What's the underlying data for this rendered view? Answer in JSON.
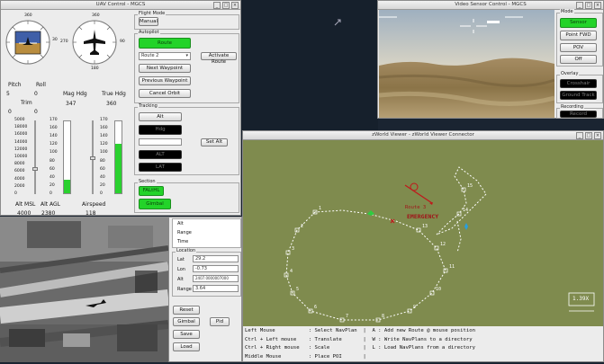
{
  "uav_window": {
    "title": "UAV Control - MGCS",
    "compass_left_labels": {
      "top": "360",
      "right": "30"
    },
    "compass_right_labels": {
      "top": "360",
      "left": "270",
      "right": "90",
      "bottom": "180"
    },
    "pitch_label": "Pitch",
    "pitch_value": "5",
    "roll_label": "Roll",
    "roll_value": "0",
    "trim_label": "Trim",
    "trim_left": "0",
    "trim_right": "0",
    "mag_hdg_label": "Mag Hdg",
    "mag_hdg_value": "347",
    "true_hdg_label": "True Hdg",
    "true_hdg_value": "360",
    "alt_msl_ticks": [
      "5000",
      "18000",
      "16000",
      "14000",
      "12000",
      "10000",
      "8000",
      "6000",
      "4000",
      "2000",
      "0"
    ],
    "alt_agl_ticks": [
      "170",
      "160",
      "140",
      "120",
      "100",
      "80",
      "60",
      "40",
      "20",
      "0"
    ],
    "airspeed_ticks": [
      "170",
      "160",
      "140",
      "120",
      "100",
      "80",
      "60",
      "40",
      "20",
      "0"
    ],
    "alt_msl_label": "Alt MSL",
    "alt_msl_value": "4000",
    "alt_agl_label": "Alt AGL",
    "alt_agl_value": "2380",
    "airspeed_label": "Airspeed",
    "airspeed_value": "118",
    "alt_agl_fill": 0.19,
    "airspeed_fill": 0.69,
    "flight_mode_group": "Flight Mode",
    "manual_button": "Manual",
    "autopilot_group": "Autopilot",
    "route_button": "Route",
    "route_select": "Route 2",
    "activate_route_button": "Activate Route",
    "next_waypoint_button": "Next Waypoint",
    "previous_waypoint_button": "Previous Waypoint",
    "cancel_orbit_button": "Cancel Orbit",
    "tracking_group": "Tracking",
    "alt_button": "Alt",
    "hdg_button": "Hdg",
    "set_alt_button": "Set Alt",
    "black_btn1": "ALT",
    "black_btn2": "LAT",
    "section_group": "Section",
    "fal_button": "FALtHL",
    "gimbal_button": "Gimbal"
  },
  "video_window": {
    "title": "Video Sensor Control - MGCS",
    "mode_group": "Mode",
    "sensor_button": "Sensor",
    "point_fwd_button": "Point FWD",
    "pov_button": "POV",
    "off_button": "Off",
    "overlay_group": "Overlay",
    "overlay_btn1": "Crosshair",
    "overlay_btn2": "Ground Track",
    "recording_group": "Recording",
    "record_button": "Record"
  },
  "info_panel": {
    "alt_label": "Alt",
    "range_label": "Range",
    "time_label": "Time",
    "location_group": "Location",
    "lat_label": "Lat",
    "lat_value": "29.2",
    "lon_label": "Lon",
    "lon_value": "-0.73",
    "alt2_label": "Alt",
    "alt2_value": "2407.0000007000",
    "range2_label": "Range",
    "range2_value": "3.64",
    "reset_button": "Reset",
    "gimbal_button": "Gimbal",
    "pid_button": "Pid",
    "save_button": "Save",
    "load_button": "Load"
  },
  "map_window": {
    "title": "zWorld Viewer - zWorld Viewer Connector",
    "emergency_label": "EMERGENCY",
    "route_label": "Route 3",
    "scale_label": "1.39X",
    "waypoint_labels": [
      "1",
      "2",
      "3",
      "4",
      "5",
      "6",
      "7",
      "8",
      "9",
      "10",
      "11",
      "12",
      "13",
      "14",
      "15"
    ],
    "help_lines": [
      "Left Mouse           : Select NavPlan  |  A : Add new Route @ mouse position",
      "Ctrl + Left mouse    : Translate       |  W : Write NavPlans to a directory",
      "Ctrl + Right mouse   : Scale           |  L : Load NavPlans from a directory",
      "Middle Mouse         : Place POI       |"
    ]
  },
  "colors": {
    "accent_green": "#23d329",
    "map_bg": "#7f8b4e",
    "desktop": "#1a2431"
  }
}
